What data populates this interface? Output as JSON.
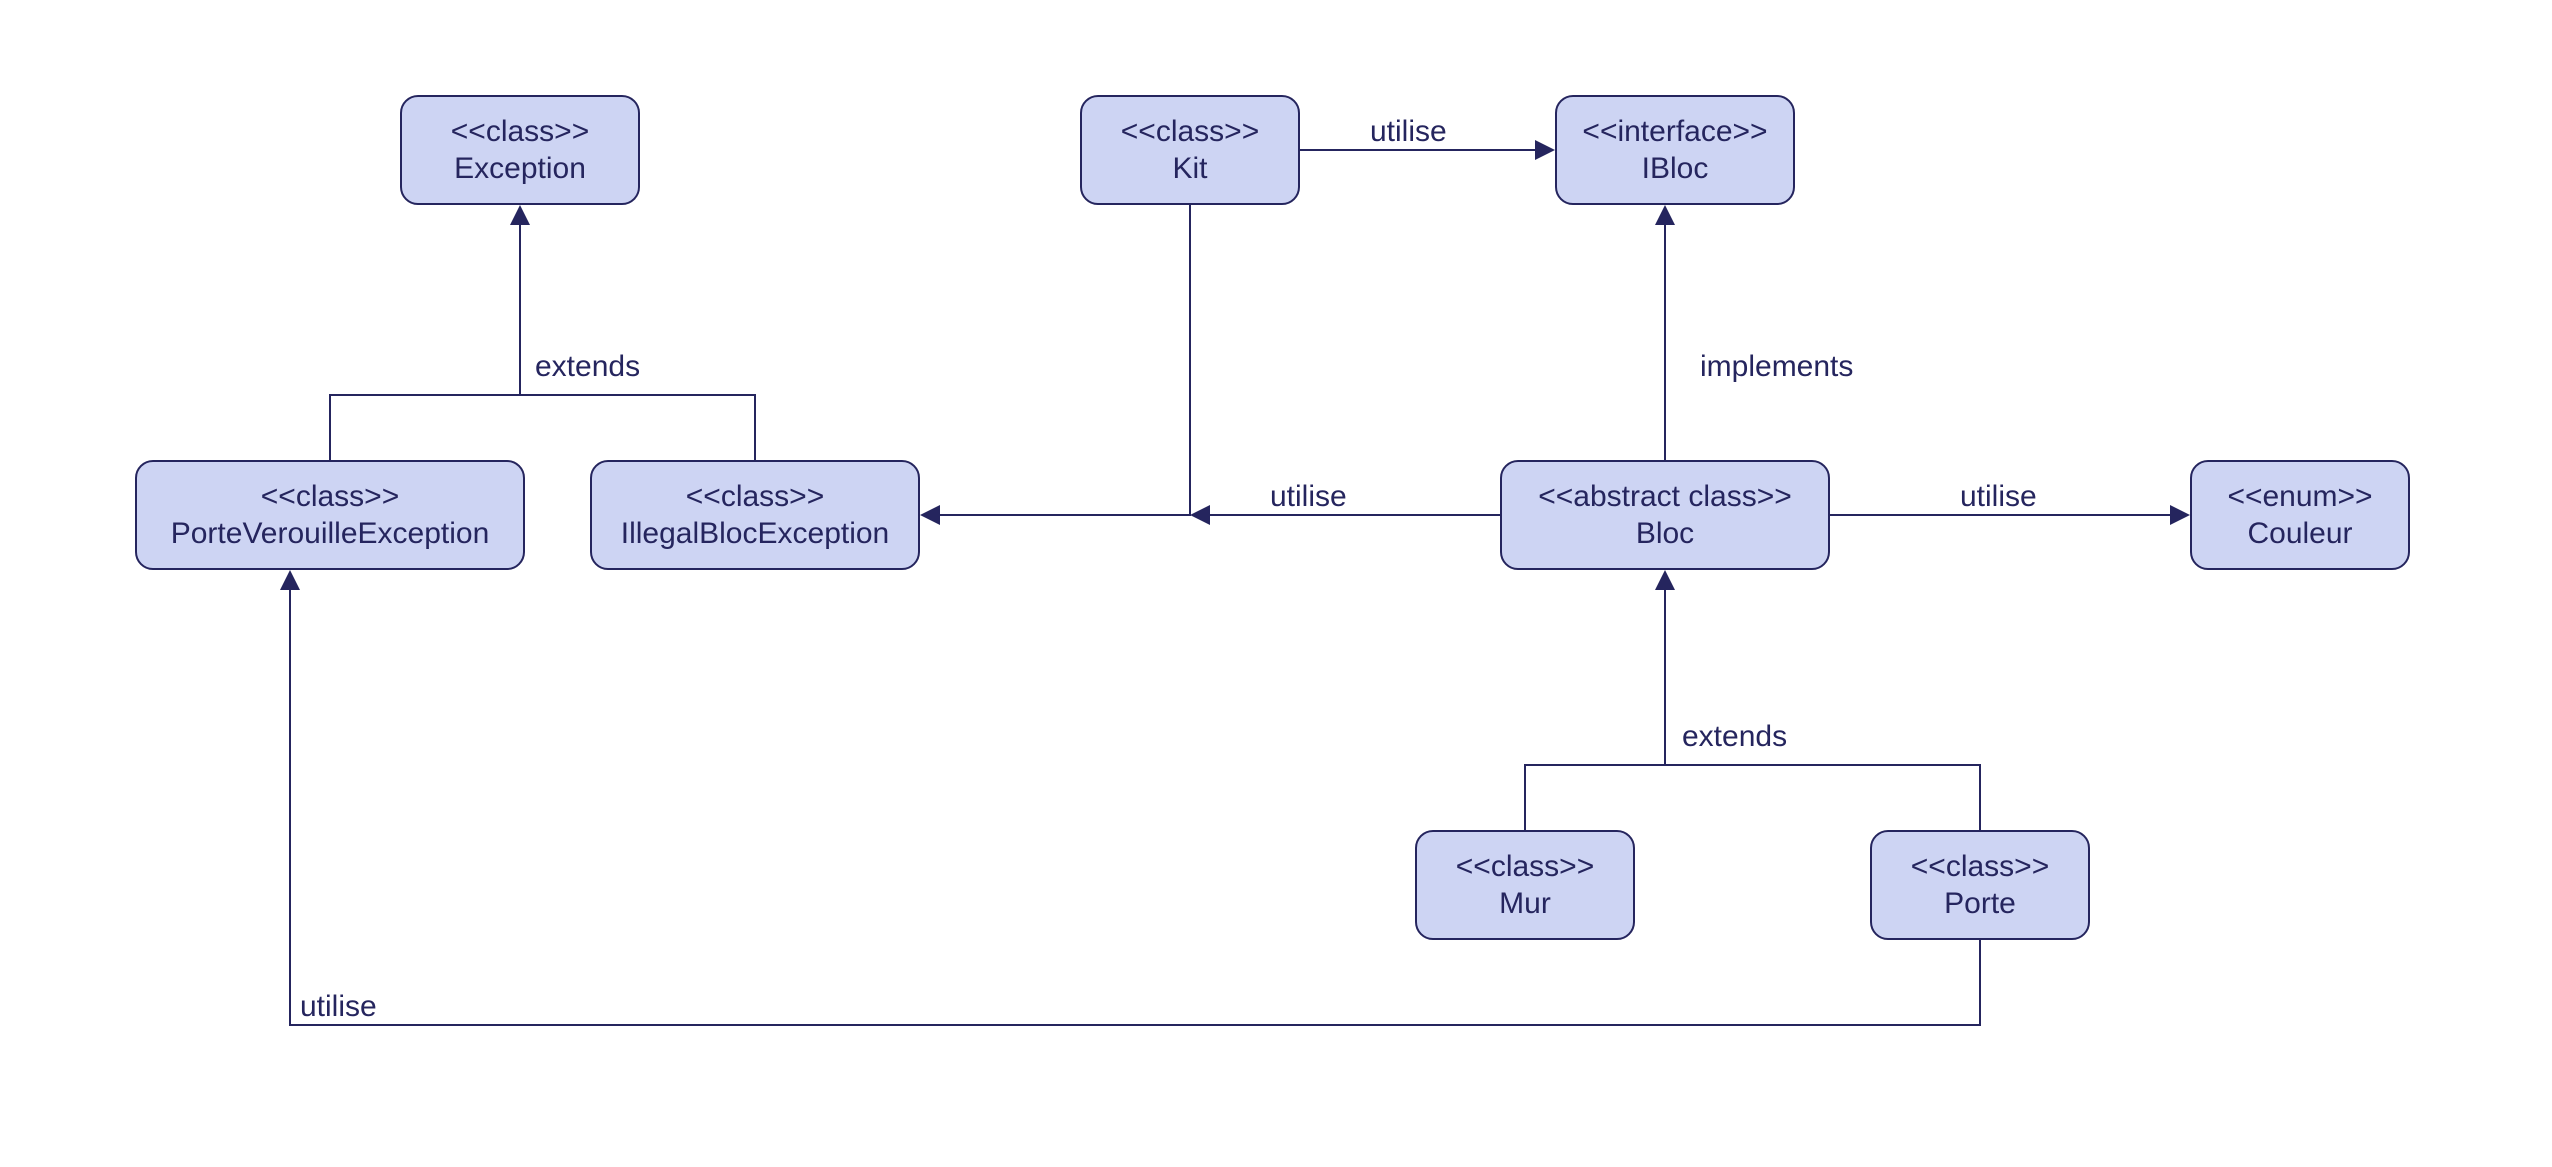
{
  "nodes": {
    "exception": {
      "stereo": "<<class>>",
      "name": "Exception"
    },
    "porteVerouilleEx": {
      "stereo": "<<class>>",
      "name": "PorteVerouilleException"
    },
    "illegalBlocEx": {
      "stereo": "<<class>>",
      "name": "IllegalBlocException"
    },
    "kit": {
      "stereo": "<<class>>",
      "name": "Kit"
    },
    "ibloc": {
      "stereo": "<<interface>>",
      "name": "IBloc"
    },
    "bloc": {
      "stereo": "<<abstract class>>",
      "name": "Bloc"
    },
    "couleur": {
      "stereo": "<<enum>>",
      "name": "Couleur"
    },
    "mur": {
      "stereo": "<<class>>",
      "name": "Mur"
    },
    "porte": {
      "stereo": "<<class>>",
      "name": "Porte"
    }
  },
  "labels": {
    "extends1": "extends",
    "extends2": "extends",
    "implements": "implements",
    "utilise1": "utilise",
    "utilise2": "utilise",
    "utilise3": "utilise",
    "utilise4": "utilise"
  }
}
